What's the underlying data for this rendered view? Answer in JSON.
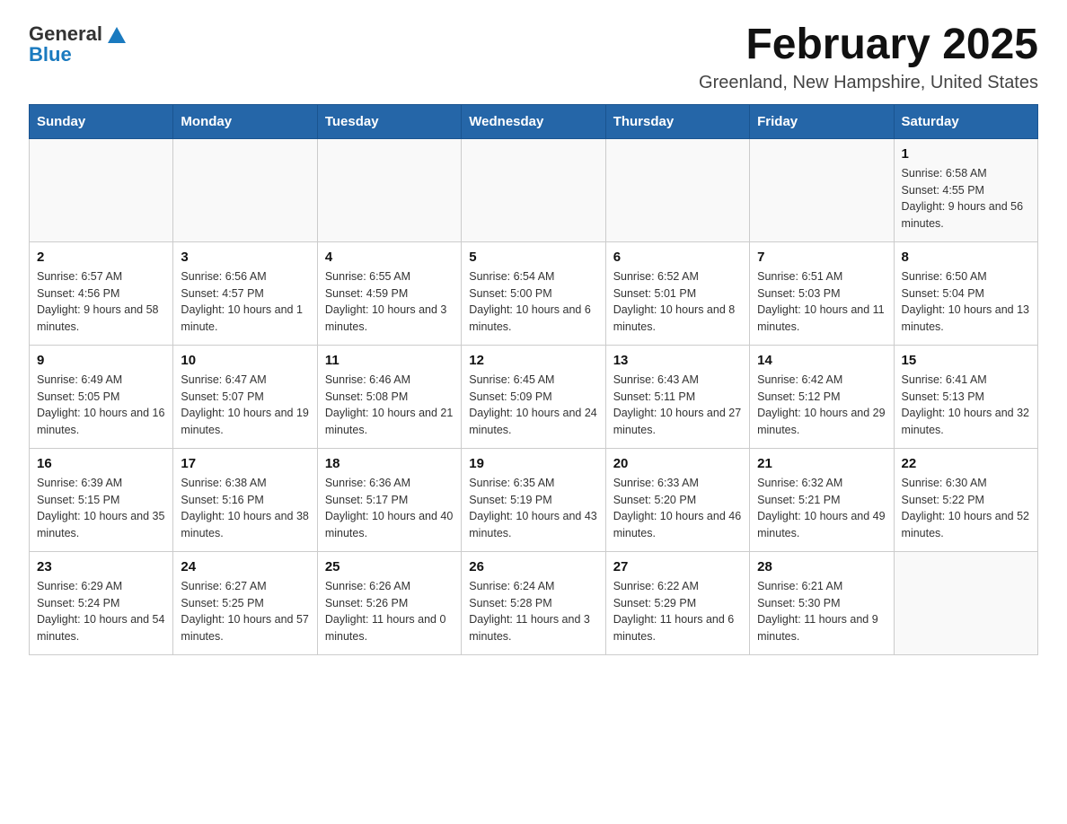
{
  "header": {
    "logo_general": "General",
    "logo_blue": "Blue",
    "title": "February 2025",
    "subtitle": "Greenland, New Hampshire, United States"
  },
  "days_of_week": [
    "Sunday",
    "Monday",
    "Tuesday",
    "Wednesday",
    "Thursday",
    "Friday",
    "Saturday"
  ],
  "weeks": [
    [
      {
        "day": "",
        "info": ""
      },
      {
        "day": "",
        "info": ""
      },
      {
        "day": "",
        "info": ""
      },
      {
        "day": "",
        "info": ""
      },
      {
        "day": "",
        "info": ""
      },
      {
        "day": "",
        "info": ""
      },
      {
        "day": "1",
        "info": "Sunrise: 6:58 AM\nSunset: 4:55 PM\nDaylight: 9 hours and 56 minutes."
      }
    ],
    [
      {
        "day": "2",
        "info": "Sunrise: 6:57 AM\nSunset: 4:56 PM\nDaylight: 9 hours and 58 minutes."
      },
      {
        "day": "3",
        "info": "Sunrise: 6:56 AM\nSunset: 4:57 PM\nDaylight: 10 hours and 1 minute."
      },
      {
        "day": "4",
        "info": "Sunrise: 6:55 AM\nSunset: 4:59 PM\nDaylight: 10 hours and 3 minutes."
      },
      {
        "day": "5",
        "info": "Sunrise: 6:54 AM\nSunset: 5:00 PM\nDaylight: 10 hours and 6 minutes."
      },
      {
        "day": "6",
        "info": "Sunrise: 6:52 AM\nSunset: 5:01 PM\nDaylight: 10 hours and 8 minutes."
      },
      {
        "day": "7",
        "info": "Sunrise: 6:51 AM\nSunset: 5:03 PM\nDaylight: 10 hours and 11 minutes."
      },
      {
        "day": "8",
        "info": "Sunrise: 6:50 AM\nSunset: 5:04 PM\nDaylight: 10 hours and 13 minutes."
      }
    ],
    [
      {
        "day": "9",
        "info": "Sunrise: 6:49 AM\nSunset: 5:05 PM\nDaylight: 10 hours and 16 minutes."
      },
      {
        "day": "10",
        "info": "Sunrise: 6:47 AM\nSunset: 5:07 PM\nDaylight: 10 hours and 19 minutes."
      },
      {
        "day": "11",
        "info": "Sunrise: 6:46 AM\nSunset: 5:08 PM\nDaylight: 10 hours and 21 minutes."
      },
      {
        "day": "12",
        "info": "Sunrise: 6:45 AM\nSunset: 5:09 PM\nDaylight: 10 hours and 24 minutes."
      },
      {
        "day": "13",
        "info": "Sunrise: 6:43 AM\nSunset: 5:11 PM\nDaylight: 10 hours and 27 minutes."
      },
      {
        "day": "14",
        "info": "Sunrise: 6:42 AM\nSunset: 5:12 PM\nDaylight: 10 hours and 29 minutes."
      },
      {
        "day": "15",
        "info": "Sunrise: 6:41 AM\nSunset: 5:13 PM\nDaylight: 10 hours and 32 minutes."
      }
    ],
    [
      {
        "day": "16",
        "info": "Sunrise: 6:39 AM\nSunset: 5:15 PM\nDaylight: 10 hours and 35 minutes."
      },
      {
        "day": "17",
        "info": "Sunrise: 6:38 AM\nSunset: 5:16 PM\nDaylight: 10 hours and 38 minutes."
      },
      {
        "day": "18",
        "info": "Sunrise: 6:36 AM\nSunset: 5:17 PM\nDaylight: 10 hours and 40 minutes."
      },
      {
        "day": "19",
        "info": "Sunrise: 6:35 AM\nSunset: 5:19 PM\nDaylight: 10 hours and 43 minutes."
      },
      {
        "day": "20",
        "info": "Sunrise: 6:33 AM\nSunset: 5:20 PM\nDaylight: 10 hours and 46 minutes."
      },
      {
        "day": "21",
        "info": "Sunrise: 6:32 AM\nSunset: 5:21 PM\nDaylight: 10 hours and 49 minutes."
      },
      {
        "day": "22",
        "info": "Sunrise: 6:30 AM\nSunset: 5:22 PM\nDaylight: 10 hours and 52 minutes."
      }
    ],
    [
      {
        "day": "23",
        "info": "Sunrise: 6:29 AM\nSunset: 5:24 PM\nDaylight: 10 hours and 54 minutes."
      },
      {
        "day": "24",
        "info": "Sunrise: 6:27 AM\nSunset: 5:25 PM\nDaylight: 10 hours and 57 minutes."
      },
      {
        "day": "25",
        "info": "Sunrise: 6:26 AM\nSunset: 5:26 PM\nDaylight: 11 hours and 0 minutes."
      },
      {
        "day": "26",
        "info": "Sunrise: 6:24 AM\nSunset: 5:28 PM\nDaylight: 11 hours and 3 minutes."
      },
      {
        "day": "27",
        "info": "Sunrise: 6:22 AM\nSunset: 5:29 PM\nDaylight: 11 hours and 6 minutes."
      },
      {
        "day": "28",
        "info": "Sunrise: 6:21 AM\nSunset: 5:30 PM\nDaylight: 11 hours and 9 minutes."
      },
      {
        "day": "",
        "info": ""
      }
    ]
  ]
}
